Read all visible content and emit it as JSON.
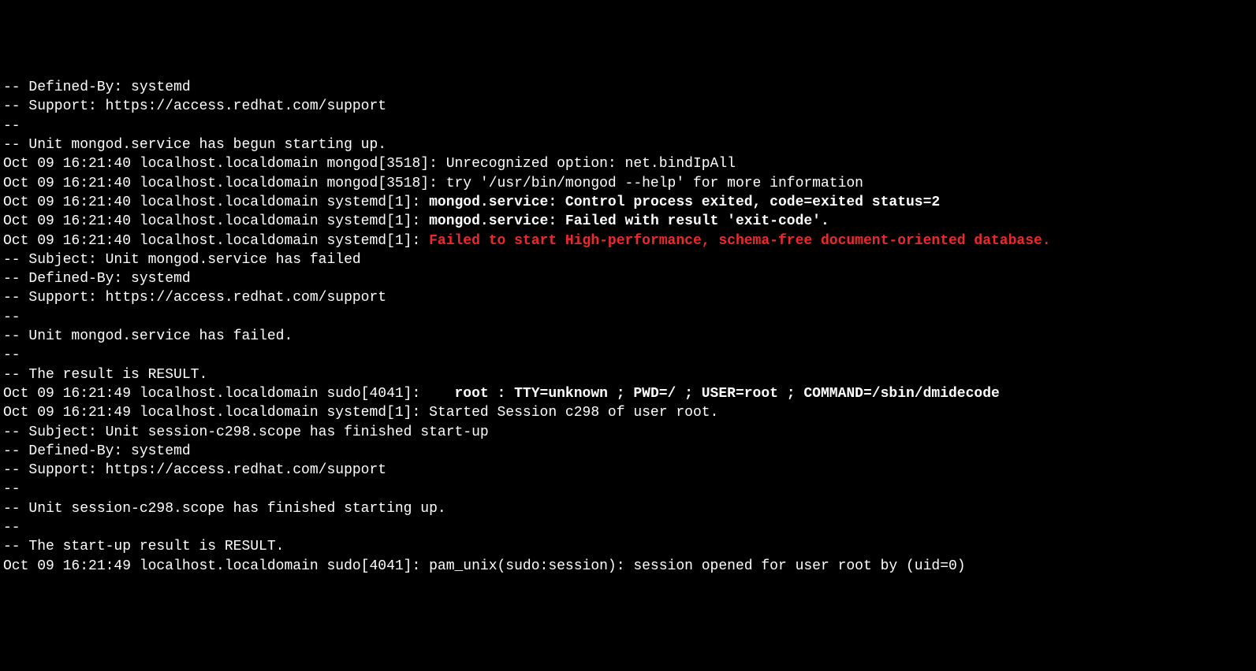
{
  "lines": [
    {
      "text": "-- Defined-By: systemd",
      "style": "normal"
    },
    {
      "text": "-- Support: https://access.redhat.com/support",
      "style": "normal"
    },
    {
      "text": "--",
      "style": "normal"
    },
    {
      "text": "-- Unit mongod.service has begun starting up.",
      "style": "normal"
    },
    {
      "text": "Oct 09 16:21:40 localhost.localdomain mongod[3518]: Unrecognized option: net.bindIpAll",
      "style": "normal"
    },
    {
      "text": "Oct 09 16:21:40 localhost.localdomain mongod[3518]: try '/usr/bin/mongod --help' for more information",
      "style": "normal"
    },
    {
      "segments": [
        {
          "text": "Oct 09 16:21:40 localhost.localdomain systemd[1]: ",
          "style": "normal"
        },
        {
          "text": "mongod.service: Control process exited, code=exited status=2",
          "style": "bold"
        }
      ]
    },
    {
      "segments": [
        {
          "text": "Oct 09 16:21:40 localhost.localdomain systemd[1]: ",
          "style": "normal"
        },
        {
          "text": "mongod.service: Failed with result 'exit-code'.",
          "style": "bold"
        }
      ]
    },
    {
      "segments": [
        {
          "text": "Oct 09 16:21:40 localhost.localdomain systemd[1]: ",
          "style": "normal"
        },
        {
          "text": "Failed to start High-performance, schema-free document-oriented database.",
          "style": "red"
        }
      ]
    },
    {
      "text": "-- Subject: Unit mongod.service has failed",
      "style": "normal"
    },
    {
      "text": "-- Defined-By: systemd",
      "style": "normal"
    },
    {
      "text": "-- Support: https://access.redhat.com/support",
      "style": "normal"
    },
    {
      "text": "--",
      "style": "normal"
    },
    {
      "text": "-- Unit mongod.service has failed.",
      "style": "normal"
    },
    {
      "text": "--",
      "style": "normal"
    },
    {
      "text": "-- The result is RESULT.",
      "style": "normal"
    },
    {
      "segments": [
        {
          "text": "Oct 09 16:21:49 localhost.localdomain sudo[4041]:    ",
          "style": "normal"
        },
        {
          "text": "root : TTY=unknown ; PWD=/ ; USER=root ; COMMAND=/sbin/dmidecode",
          "style": "bold"
        }
      ]
    },
    {
      "text": "Oct 09 16:21:49 localhost.localdomain systemd[1]: Started Session c298 of user root.",
      "style": "normal"
    },
    {
      "text": "-- Subject: Unit session-c298.scope has finished start-up",
      "style": "normal"
    },
    {
      "text": "-- Defined-By: systemd",
      "style": "normal"
    },
    {
      "text": "-- Support: https://access.redhat.com/support",
      "style": "normal"
    },
    {
      "text": "--",
      "style": "normal"
    },
    {
      "text": "-- Unit session-c298.scope has finished starting up.",
      "style": "normal"
    },
    {
      "text": "--",
      "style": "normal"
    },
    {
      "text": "-- The start-up result is RESULT.",
      "style": "normal"
    },
    {
      "text": "Oct 09 16:21:49 localhost.localdomain sudo[4041]: pam_unix(sudo:session): session opened for user root by (uid=0)",
      "style": "normal"
    }
  ]
}
